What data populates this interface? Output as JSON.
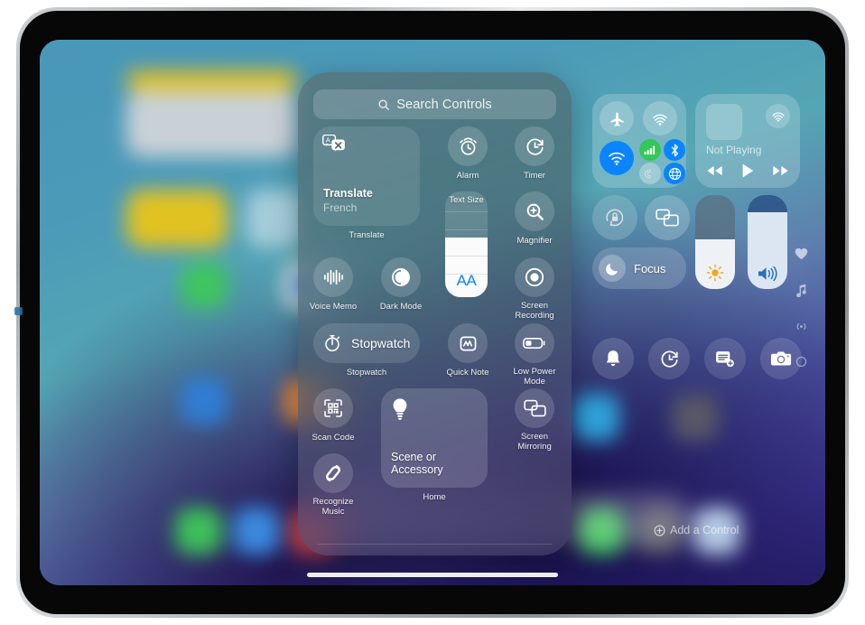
{
  "device": {
    "name": "iPad",
    "side_marker": ""
  },
  "search": {
    "placeholder": "Search Controls",
    "icon": "search-icon"
  },
  "controls_panel": {
    "items": [
      {
        "id": "translate",
        "type": "tile",
        "label": "Translate",
        "title": "Translate",
        "subtitle": "French",
        "icon": "translate-icon"
      },
      {
        "id": "alarm",
        "type": "circle",
        "label": "Alarm",
        "icon": "alarm-clock-icon"
      },
      {
        "id": "timer",
        "type": "circle",
        "label": "Timer",
        "icon": "timer-icon"
      },
      {
        "id": "magnifier",
        "type": "circle",
        "label": "Magnifier",
        "icon": "magnifier-icon"
      },
      {
        "id": "text-size",
        "type": "slider",
        "label": "Text Size",
        "value_text": "AA",
        "fill_percent": 56,
        "accent": "#0a84ff"
      },
      {
        "id": "voice-memo",
        "type": "circle",
        "label": "Voice Memo",
        "icon": "waveform-icon"
      },
      {
        "id": "dark-mode",
        "type": "circle",
        "label": "Dark Mode",
        "icon": "dark-mode-icon"
      },
      {
        "id": "screen-recording",
        "type": "circle",
        "label": "Screen Recording",
        "icon": "record-icon"
      },
      {
        "id": "stopwatch",
        "type": "pill",
        "label": "Stopwatch",
        "title": "Stopwatch",
        "icon": "stopwatch-icon"
      },
      {
        "id": "quick-note",
        "type": "circle",
        "label": "Quick Note",
        "icon": "quick-note-icon"
      },
      {
        "id": "low-power-mode",
        "type": "circle",
        "label": "Low Power Mode",
        "icon": "battery-icon"
      },
      {
        "id": "scan-code",
        "type": "circle",
        "label": "Scan Code",
        "icon": "qr-code-icon"
      },
      {
        "id": "home",
        "type": "tile",
        "label": "Home",
        "title": "Scene or Accessory",
        "icon": "lightbulb-icon"
      },
      {
        "id": "screen-mirroring",
        "type": "circle",
        "label": "Screen Mirroring",
        "icon": "screen-mirroring-icon"
      },
      {
        "id": "recognize-music",
        "type": "circle",
        "label": "Recognize Music",
        "icon": "shazam-icon"
      }
    ]
  },
  "modules": {
    "connectivity": {
      "name": "connectivity-module",
      "buttons": [
        {
          "id": "airplane-mode",
          "label": "Airplane Mode",
          "icon": "airplane-icon",
          "active": false
        },
        {
          "id": "airdrop",
          "label": "AirDrop",
          "icon": "airdrop-icon",
          "active": false
        },
        {
          "id": "wifi",
          "label": "Wi-Fi",
          "icon": "wifi-icon",
          "active": true,
          "color": "#0a84ff"
        },
        {
          "id": "cellular",
          "label": "Cellular Data",
          "icon": "cellular-bars-icon",
          "active": true,
          "color": "#34c759"
        },
        {
          "id": "bluetooth",
          "label": "Bluetooth",
          "icon": "bluetooth-icon",
          "active": true,
          "color": "#0a84ff"
        },
        {
          "id": "personal-hotspot",
          "label": "Personal Hotspot",
          "icon": "hotspot-icon",
          "active": false
        },
        {
          "id": "vpn",
          "label": "VPN",
          "icon": "globe-icon",
          "active": true,
          "color": "#0a84ff"
        }
      ]
    },
    "media": {
      "name": "now-playing-module",
      "status": "Not Playing",
      "airplay_icon": "airplay-audio-icon",
      "transport": [
        {
          "id": "rewind",
          "label": "Rewind",
          "icon": "rewind-icon"
        },
        {
          "id": "play",
          "label": "Play",
          "icon": "play-icon"
        },
        {
          "id": "fast-forward",
          "label": "Fast Forward",
          "icon": "fast-forward-icon"
        }
      ]
    },
    "rotation_lock": {
      "label": "Rotation Lock",
      "icon": "rotation-lock-icon",
      "active": false
    },
    "screen_mirroring": {
      "label": "Screen Mirroring",
      "icon": "screen-mirroring-icon"
    },
    "focus": {
      "label": "Focus",
      "icon": "moon-icon"
    },
    "brightness": {
      "label": "Brightness",
      "icon": "sun-icon",
      "fill_percent": 53,
      "accent": "#f5a623"
    },
    "volume": {
      "label": "Volume",
      "icon": "speaker-waves-icon",
      "fill_percent": 82,
      "accent": "#2a72b8"
    }
  },
  "bottom_row": [
    {
      "id": "silent-mode",
      "label": "Silent Mode",
      "icon": "bell-icon"
    },
    {
      "id": "timer-shortcut",
      "label": "Timer",
      "icon": "timer-icon"
    },
    {
      "id": "quick-note-shortcut",
      "label": "Quick Note",
      "icon": "quick-note-icon"
    },
    {
      "id": "camera-shortcut",
      "label": "Camera",
      "icon": "camera-icon"
    }
  ],
  "right_rail": [
    {
      "id": "favorites-page",
      "label": "Favorites",
      "icon": "heart-icon"
    },
    {
      "id": "music-page",
      "label": "Music",
      "icon": "music-note-icon"
    },
    {
      "id": "connectivity-page",
      "label": "Connectivity",
      "icon": "hotspot-icon"
    },
    {
      "id": "more-page",
      "label": "More",
      "icon": "circle-outline-icon"
    }
  ],
  "add_control": {
    "label": "Add a Control",
    "icon": "plus-circle-icon"
  },
  "home_indicator": {
    "label": "Home Indicator"
  },
  "colors": {
    "accent_blue": "#0a84ff",
    "green": "#34c759",
    "orange": "#f5a623",
    "text_size_blue": "#0a84ff"
  }
}
